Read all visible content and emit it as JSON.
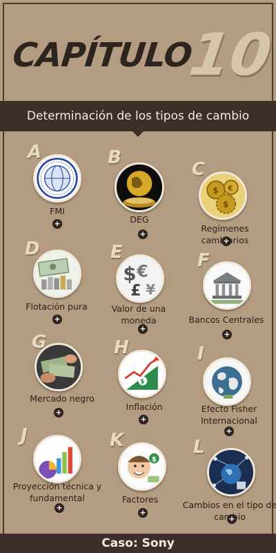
{
  "header": {
    "chapter_word": "CAPÍTULO :",
    "chapter_number": "10"
  },
  "banner": {
    "title": "Determinación de los tipos de cambio"
  },
  "topics": [
    {
      "letter": "A",
      "label": "FMI",
      "icon": "imf-seal-icon"
    },
    {
      "letter": "B",
      "label": "DEG",
      "icon": "globe-coins-icon"
    },
    {
      "letter": "C",
      "label": "Regímenes cambiarios",
      "icon": "gear-coins-icon"
    },
    {
      "letter": "D",
      "label": "Flotación pura",
      "icon": "banknotes-coins-icon"
    },
    {
      "letter": "E",
      "label": "Valor de una moneda",
      "icon": "currency-symbols-icon"
    },
    {
      "letter": "F",
      "label": "Bancos Centrales",
      "icon": "bank-building-icon"
    },
    {
      "letter": "G",
      "label": "Mercado negro",
      "icon": "cash-handshake-icon"
    },
    {
      "letter": "H",
      "label": "Inflación",
      "icon": "rising-money-chart-icon"
    },
    {
      "letter": "I",
      "label": "Efecto Fisher Internacional",
      "icon": "world-map-icon"
    },
    {
      "letter": "J",
      "label": "Proyección técnica y fundamental",
      "icon": "bar-pie-chart-icon"
    },
    {
      "letter": "K",
      "label": "Factores",
      "icon": "smiling-man-icon"
    },
    {
      "letter": "L",
      "label": "Cambios en el tipo de cambio",
      "icon": "network-globe-icon"
    }
  ],
  "expand_symbol": "+",
  "footer": {
    "label": "Caso: Sony"
  },
  "colors": {
    "background": "#b39c81",
    "dark": "#3d2e27",
    "accent": "#d6c6ab"
  }
}
